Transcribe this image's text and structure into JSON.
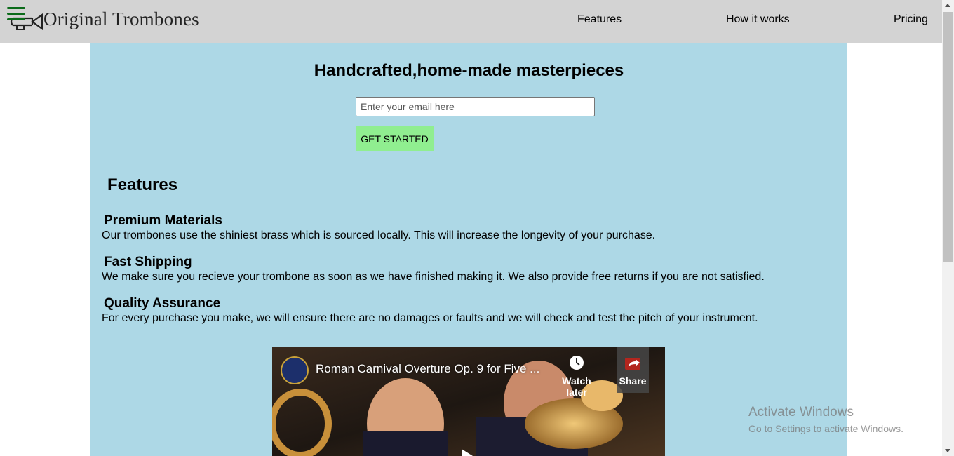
{
  "header": {
    "logo_text": "Original Trombones",
    "nav": [
      {
        "label": "Features"
      },
      {
        "label": "How it works"
      },
      {
        "label": "Pricing"
      }
    ]
  },
  "hero": {
    "title": "Handcrafted,home-made masterpieces",
    "email_placeholder": "Enter your email here",
    "button_label": "GET STARTED"
  },
  "features": {
    "heading": "Features",
    "items": [
      {
        "title": "Premium Materials",
        "text": "Our trombones use the shiniest brass which is sourced locally. This will increase the longevity of your purchase."
      },
      {
        "title": "Fast Shipping",
        "text": "We make sure you recieve your trombone as soon as we have finished making it. We also provide free returns if you are not satisfied."
      },
      {
        "title": "Quality Assurance",
        "text": "For every purchase you make, we will ensure there are no damages or faults and we will check and test the pitch of your instrument."
      }
    ]
  },
  "video": {
    "title": "Roman Carnival Overture Op. 9 for Five ...",
    "watch_later": "Watch later",
    "share": "Share"
  },
  "watermark": {
    "line1": "Activate Windows",
    "line2": "Go to Settings to activate Windows."
  },
  "colors": {
    "header_bg": "#d3d3d3",
    "main_bg": "#add8e6",
    "button_bg": "#90ee90",
    "hamburger": "#0b6b1a"
  },
  "icons": [
    "menu-icon",
    "trombone-logo-icon",
    "clock-icon",
    "share-icon",
    "play-icon"
  ]
}
